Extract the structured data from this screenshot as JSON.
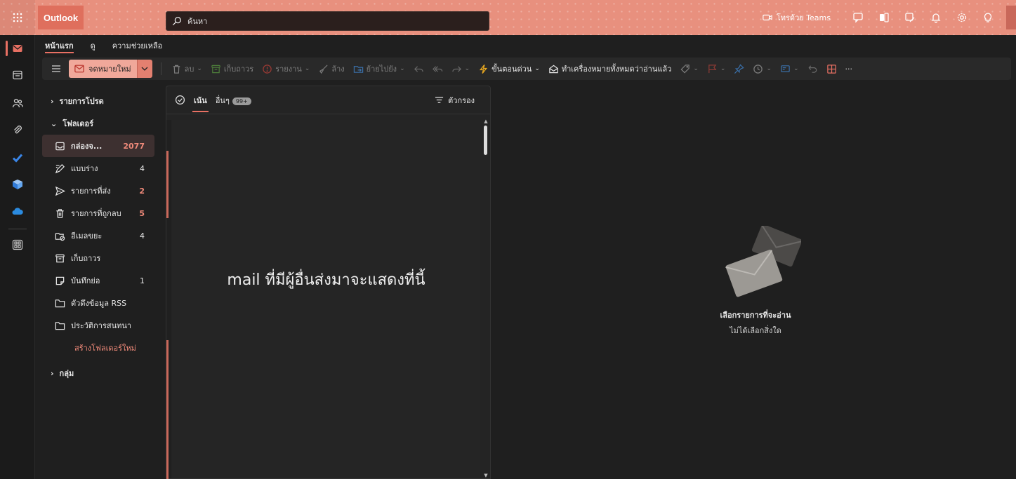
{
  "app": {
    "name": "Outlook"
  },
  "search": {
    "placeholder": "ค้นหา"
  },
  "header": {
    "teams_label": "โทรด้วย Teams",
    "icons": [
      "teams-icon",
      "chat-icon",
      "office-icon",
      "whiteboard-icon",
      "bell-icon",
      "gear-icon",
      "lightbulb-icon"
    ]
  },
  "rail": [
    "mail-icon",
    "calendar-icon",
    "people-icon",
    "attach-icon",
    "todo-icon",
    "viva-icon",
    "onedrive-icon",
    "apps-icon"
  ],
  "menu_tabs": [
    "หน้าแรก",
    "ดู",
    "ความช่วยเหลือ"
  ],
  "ribbon": {
    "new_mail": "จดหมายใหม่",
    "delete": "ลบ",
    "archive": "เก็บถาวร",
    "report": "รายงาน",
    "sweep": "ล้าง",
    "move_to": "ย้ายไปยัง",
    "quick_steps": "ขั้นตอนด่วน",
    "mark_all_read": "ทำเครื่องหมายทั้งหมดว่าอ่านแล้ว",
    "more": "···"
  },
  "folders": {
    "favorites": "รายการโปรด",
    "folders_header": "โฟลเดอร์",
    "items": [
      {
        "label": "กล่องจ...",
        "count": "2077",
        "icon": "inbox-icon"
      },
      {
        "label": "แบบร่าง",
        "count": "4",
        "icon": "drafts-icon"
      },
      {
        "label": "รายการที่ส่ง",
        "count": "2",
        "icon": "sent-icon"
      },
      {
        "label": "รายการที่ถูกลบ",
        "count": "5",
        "icon": "trash-icon"
      },
      {
        "label": "อีเมลขยะ",
        "count": "4",
        "icon": "junk-icon"
      },
      {
        "label": "เก็บถาวร",
        "count": "",
        "icon": "archive-icon"
      },
      {
        "label": "บันทึกย่อ",
        "count": "1",
        "icon": "notes-icon"
      },
      {
        "label": "ตัวดึงข้อมูล RSS",
        "count": "",
        "icon": "folder-icon"
      },
      {
        "label": "ประวัติการสนทนา",
        "count": "",
        "icon": "folder-icon"
      }
    ],
    "new_folder": "สร้างโฟลเดอร์ใหม่",
    "groups": "กลุ่ม"
  },
  "message_list": {
    "tab_focused": "เน้น",
    "tab_other": "อื่นๆ",
    "other_badge": "99+",
    "filter": "ตัวกรอง",
    "placeholder": "mail ที่มีผู้อื่นส่งมาจะแสดงที่นี้"
  },
  "reading_pane": {
    "title": "เลือกรายการที่จะอ่าน",
    "subtitle": "ไม่ได้เลือกสิ่งใด"
  }
}
